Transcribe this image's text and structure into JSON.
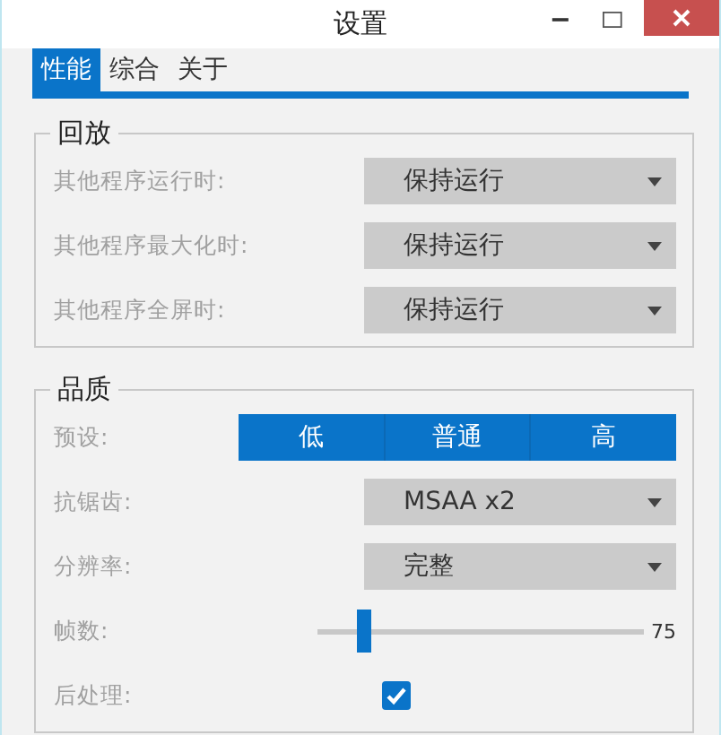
{
  "window": {
    "title": "设置"
  },
  "tabs": [
    {
      "label": "性能",
      "selected": true
    },
    {
      "label": "综合",
      "selected": false
    },
    {
      "label": "关于",
      "selected": false
    }
  ],
  "playback": {
    "title": "回放",
    "rows": [
      {
        "label": "其他程序运行时:",
        "value": "保持运行"
      },
      {
        "label": "其他程序最大化时:",
        "value": "保持运行"
      },
      {
        "label": "其他程序全屏时:",
        "value": "保持运行"
      }
    ]
  },
  "quality": {
    "title": "品质",
    "rows": [
      {
        "kind": "segmented",
        "label": "预设:",
        "options": [
          "低",
          "普通",
          "高"
        ]
      },
      {
        "kind": "dropdown",
        "label": "抗锯齿:",
        "value": "MSAA x2"
      },
      {
        "kind": "dropdown",
        "label": "分辨率:",
        "value": "完整"
      },
      {
        "kind": "slider",
        "label": "帧数:",
        "level": 0.12,
        "reading": "75"
      },
      {
        "kind": "checkbox",
        "label": "后处理:",
        "checked": true
      }
    ]
  }
}
